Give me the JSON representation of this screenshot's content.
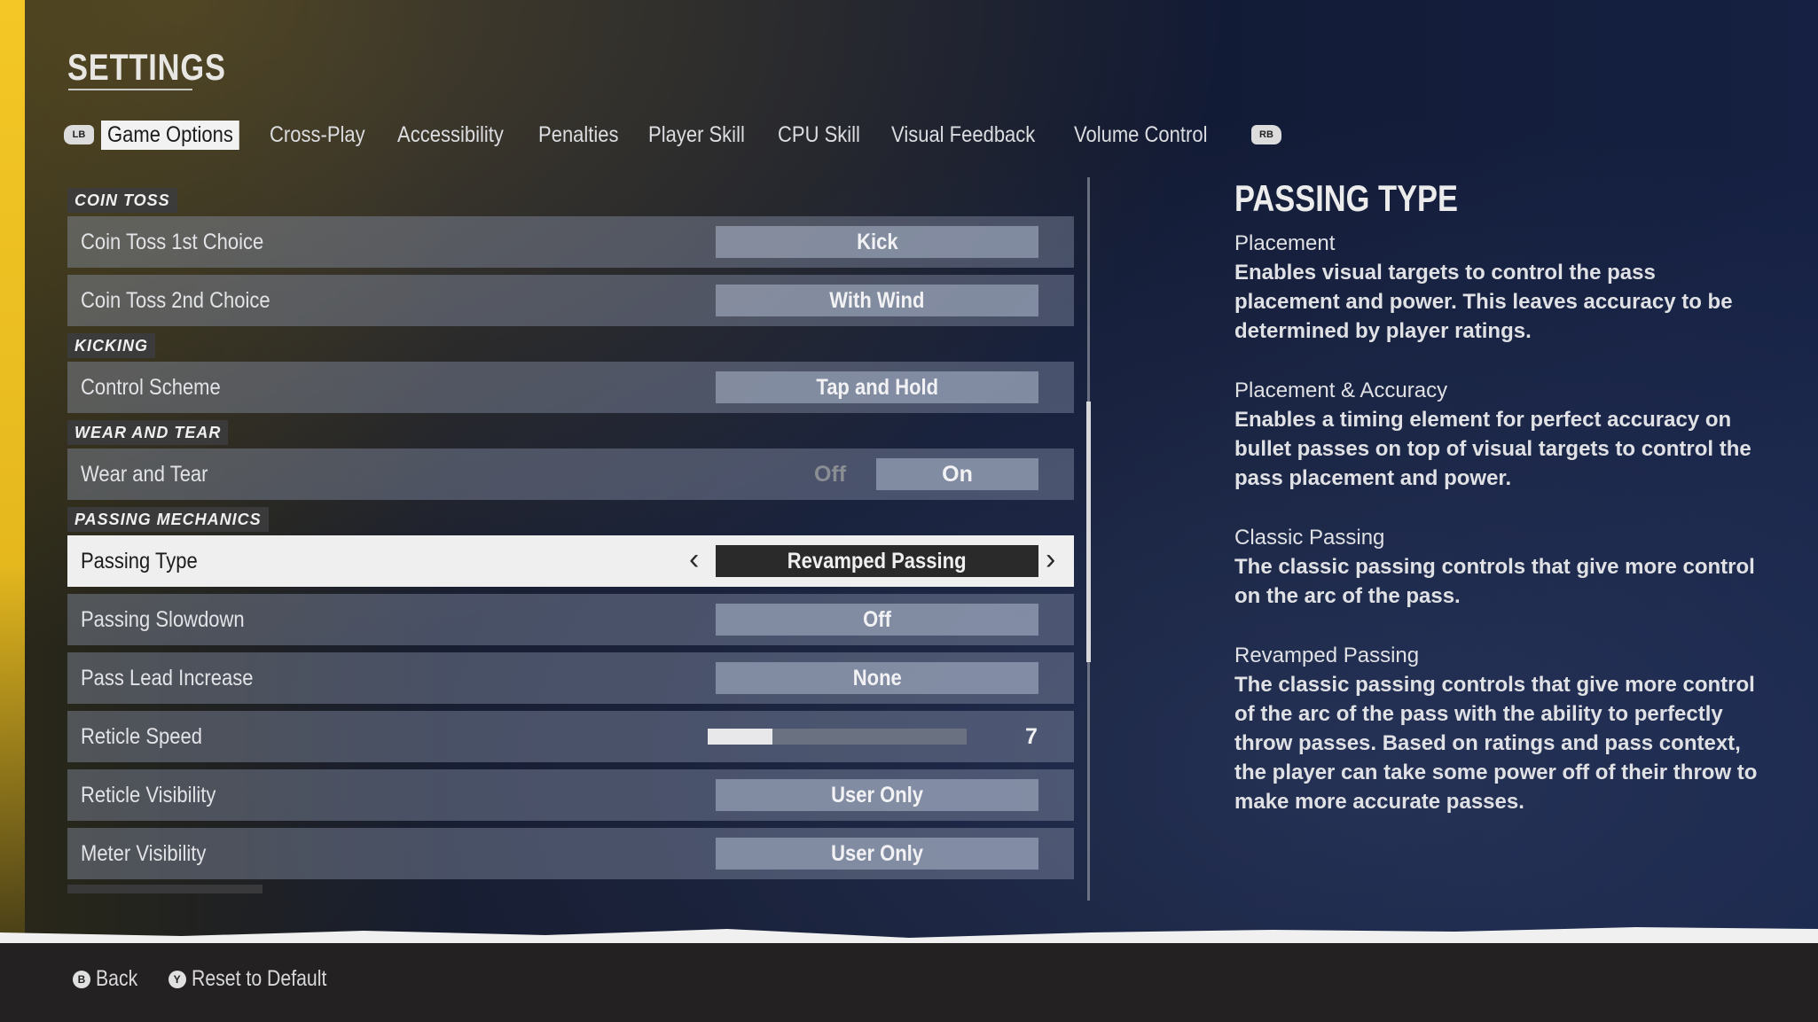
{
  "page": {
    "title": "SETTINGS"
  },
  "tabs": {
    "left_bumper": "LB",
    "right_bumper": "RB",
    "items": [
      {
        "label": "Game Options",
        "active": true
      },
      {
        "label": "Cross-Play"
      },
      {
        "label": "Accessibility"
      },
      {
        "label": "Penalties"
      },
      {
        "label": "Player Skill"
      },
      {
        "label": "CPU Skill"
      },
      {
        "label": "Visual Feedback"
      },
      {
        "label": "Volume Control"
      }
    ]
  },
  "sections": {
    "coin_toss": {
      "label": "COIN TOSS",
      "rows": [
        {
          "label": "Coin Toss 1st Choice",
          "value": "Kick"
        },
        {
          "label": "Coin Toss 2nd Choice",
          "value": "With Wind"
        }
      ]
    },
    "kicking": {
      "label": "KICKING",
      "rows": [
        {
          "label": "Control Scheme",
          "value": "Tap and Hold"
        }
      ]
    },
    "wear_and_tear": {
      "label": "WEAR AND TEAR",
      "rows": [
        {
          "label": "Wear and Tear",
          "off_label": "Off",
          "on_label": "On",
          "value": "On"
        }
      ]
    },
    "passing_mechanics": {
      "label": "PASSING MECHANICS",
      "rows": [
        {
          "label": "Passing Type",
          "value": "Revamped Passing",
          "selected": true
        },
        {
          "label": "Passing Slowdown",
          "value": "Off"
        },
        {
          "label": "Pass Lead Increase",
          "value": "None"
        },
        {
          "label": "Reticle Speed",
          "value": "7",
          "slider_fraction": 0.25
        },
        {
          "label": "Reticle Visibility",
          "value": "User Only"
        },
        {
          "label": "Meter Visibility",
          "value": "User Only"
        }
      ]
    }
  },
  "scrollbar": {
    "thumb_start_fraction": 0.31,
    "thumb_length_fraction": 0.36
  },
  "detail": {
    "title": "PASSING TYPE",
    "entries": [
      {
        "name": "Placement",
        "desc": "Enables visual targets to control the pass placement and power. This leaves accuracy to be determined by player ratings."
      },
      {
        "name": "Placement & Accuracy",
        "desc": "Enables a timing element for perfect accuracy on bullet passes on top of visual targets to control the pass placement and power."
      },
      {
        "name": "Classic Passing",
        "desc": "The classic passing controls that give more control on the arc of the pass."
      },
      {
        "name": "Revamped Passing",
        "desc": "The classic passing controls that give more control of the arc of the pass with the ability to perfectly throw passes. Based on ratings and pass context, the player can take some power off of their throw to make more accurate passes."
      }
    ]
  },
  "footer": {
    "back": {
      "glyph": "B",
      "label": "Back"
    },
    "reset": {
      "glyph": "Y",
      "label": "Reset to Default"
    }
  }
}
